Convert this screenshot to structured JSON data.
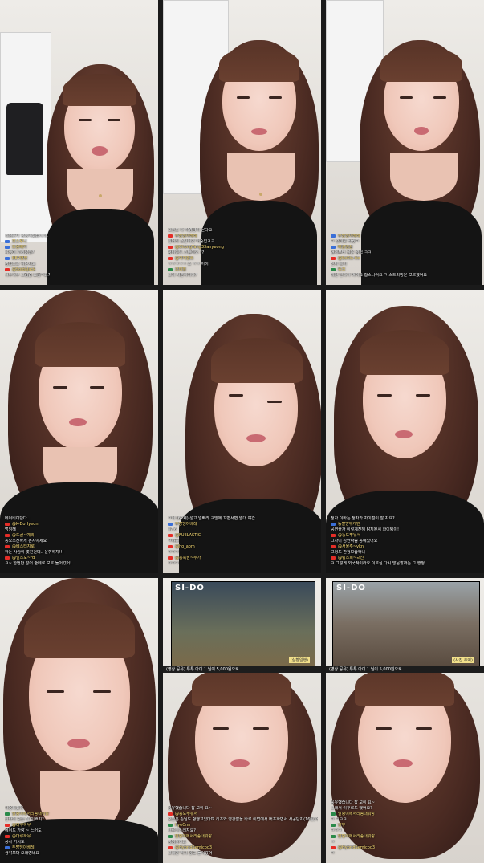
{
  "grid_title": "",
  "tiles": [
    {
      "id": 1,
      "chat": [
        {
          "badge": "none",
          "text": "데일몬이 생생이었습니다."
        },
        {
          "badge": "blue",
          "nick": "보스후니",
          "text": ""
        },
        {
          "badge": "blue",
          "nick": "트윈빼키",
          "text": ""
        },
        {
          "badge": "none",
          "text": "야생에 꼬리장쉽?"
        },
        {
          "badge": "blue",
          "nick": "BEV별빛",
          "text": ""
        },
        {
          "badge": "none",
          "text": "경험으로 쉬운세요"
        },
        {
          "badge": "yt",
          "nick": "@SoldaJack",
          "text": ""
        },
        {
          "badge": "none",
          "text": "너무너무 그럼숍 요즘ㅋ요?"
        }
      ]
    },
    {
      "id": 2,
      "chat": [
        {
          "badge": "none",
          "text": "오늘도 다 야경양이 몬다요"
        },
        {
          "badge": "yt",
          "nick": "두방딩이베레",
          "text": ""
        },
        {
          "badge": "none",
          "text": "흰머리 스탄이면 허중입ㅋㅋ"
        },
        {
          "badge": "yt",
          "nick": "@ChongYang33anyeong",
          "text": ""
        },
        {
          "badge": "none",
          "text": "정비인트 스탠이요 ??"
        },
        {
          "badge": "yt",
          "nick": "@이이합쓰",
          "text": ""
        },
        {
          "badge": "none",
          "text": "ㅋㅋㅋㅋㅋ 쓰 ㅋㅋ 아이"
        },
        {
          "badge": "green",
          "nick": "오미월",
          "text": ""
        },
        {
          "badge": "none",
          "text": "그저 저뿐이지다?"
        }
      ]
    },
    {
      "id": 3,
      "chat": [
        {
          "badge": "blue",
          "nick": "두방딩이베레",
          "text": ""
        },
        {
          "badge": "none",
          "text": "ㅋ 흥미로 바웠ㅋ"
        },
        {
          "badge": "blue",
          "nick": "빠갈임심",
          "text": ""
        },
        {
          "badge": "none",
          "text": "언제부터 실은 경험 ㅋㅋ"
        },
        {
          "badge": "yt",
          "nick": "@SoKia-ito",
          "text": ""
        },
        {
          "badge": "none",
          "text": "진짜 흐이"
        },
        {
          "badge": "green",
          "nick": "뉴크",
          "text": ""
        },
        {
          "badge": "none",
          "text": "예전 닌다가 머이요 합스니어요 ㅋ 스트리밍은 모르겠어요"
        }
      ]
    },
    {
      "id": 4,
      "chat": [
        {
          "badge": "none",
          "text": "데이비이단다.."
        },
        {
          "badge": "yt",
          "nick": "@K-DoHyeon",
          "text": ""
        },
        {
          "badge": "none",
          "text": "멍임해"
        },
        {
          "badge": "yt",
          "nick": "@도골~예리",
          "text": ""
        },
        {
          "badge": "none",
          "text": "응오소진하게 몬지아세요"
        },
        {
          "badge": "yt",
          "nick": "@베스터지로",
          "text": ""
        },
        {
          "badge": "none",
          "text": "하는 사람이 멋진건데.. 운휘하지!!!"
        },
        {
          "badge": "yt",
          "nick": "@밀스포~rd",
          "text": ""
        },
        {
          "badge": "none",
          "text": "ㅋ~ 한번만 성어 줄테로 모르 들어갔어!"
        }
      ]
    },
    {
      "id": 5,
      "chat": [
        {
          "badge": "none",
          "text": "ㅋ이 (62세) 성고 얼빠라 ㅋ빙에 꼬면서면 열대 야간"
        },
        {
          "badge": "blue",
          "nick": "두방딩이베레",
          "text": ""
        },
        {
          "badge": "none",
          "text": "87.6"
        },
        {
          "badge": "yt",
          "nick": "@FUELASTIC",
          "text": ""
        },
        {
          "badge": "none",
          "text": "ㅋ야동"
        },
        {
          "badge": "yt",
          "nick": "@ho_aom",
          "text": ""
        },
        {
          "badge": "none",
          "text": "ㅋㅋㅋ"
        },
        {
          "badge": "yt",
          "nick": "@뭉뚝삼~추가",
          "text": ""
        },
        {
          "badge": "none",
          "text": "ㅋㅋㅋ"
        }
      ]
    },
    {
      "id": 6,
      "chat": [
        {
          "badge": "none",
          "text": "정자 이바는 정자가 차이점이 잘 자요?"
        },
        {
          "badge": "blue",
          "nick": "동팔방투개반",
          "text": ""
        },
        {
          "badge": "none",
          "text": "공연출가 이렇게진해 탐지된서 화이팅이!"
        },
        {
          "badge": "yt",
          "nick": "@동도뿌유서",
          "text": ""
        },
        {
          "badge": "none",
          "text": "그사이 성안싸쯤 응예있어요"
        },
        {
          "badge": "yt",
          "nick": "@서울주~vkn",
          "text": ""
        },
        {
          "badge": "none",
          "text": "그정도 판정모습하니"
        },
        {
          "badge": "yt",
          "nick": "@링스희~ㄹ신",
          "text": ""
        },
        {
          "badge": "none",
          "text": "ㅋ 그렇게 외국적이라요 이르실 다시 방문할까는 그 행정"
        }
      ]
    },
    {
      "id": 7,
      "chat": [
        {
          "badge": "none",
          "text": "사용되겠네"
        },
        {
          "badge": "green",
          "nick": "말벙이에서리종내뭐랑",
          "text": ""
        },
        {
          "badge": "none",
          "text": "한바의 오늘 잠 이쁘지?"
        },
        {
          "badge": "yt",
          "nick": "@마루하우",
          "text": ""
        },
        {
          "badge": "none",
          "text": "에이드 가랑 ~ 느어도"
        },
        {
          "badge": "yt",
          "nick": "@마루하우",
          "text": ""
        },
        {
          "badge": "none",
          "text": "공사 가시도"
        },
        {
          "badge": "blue",
          "nick": "두방딩이베레",
          "text": ""
        },
        {
          "badge": "none",
          "text": "생각보다 오래영네요"
        }
      ]
    },
    {
      "id": 8,
      "overlay_logo": "SI-DO",
      "overlay_tag": "(실황일행)",
      "chat_header": "(영상 공유) 투투 아이 1 님이 5,000원으로",
      "chat": [
        {
          "badge": "none",
          "text": "공유했습니다 잡 보이 요~"
        },
        {
          "badge": "yt",
          "nick": "@동도뿌유서",
          "text": ""
        },
        {
          "badge": "none",
          "text": "오늘은 손님도 헝맹고있다며 리초와 영강잘을 바로 이법에서 버프하면서 서공단지(16원)에서 좋 이유하다에서 다 두고만선이 해진다 7777버지도 이렇게 이중선 지오장역 가정할하네요"
        },
        {
          "badge": "green",
          "nick": "hyeOnn",
          "text": ""
        },
        {
          "badge": "none",
          "text": "다루니스레지요?"
        },
        {
          "badge": "green",
          "nick": "말벙이에서리종내뭐랑",
          "text": ""
        },
        {
          "badge": "none",
          "text": "병님깜이요"
        },
        {
          "badge": "yt",
          "nick": "@HybridSemicoo3",
          "text": ""
        },
        {
          "badge": "none",
          "text": "그래면 역시 공도 들어갔어"
        }
      ]
    },
    {
      "id": 9,
      "overlay_logo": "SI-DO",
      "overlay_tag": "(사진 추억)",
      "chat_header": "(영상 공유) 투투 아이 1 님이 5,000원으로",
      "chat": [
        {
          "badge": "none",
          "text": "공유했습니다 잡 보이 요~"
        },
        {
          "badge": "none",
          "text": "그래서 이후로도 했어요?"
        },
        {
          "badge": "green",
          "nick": "말벙이에서리종내뭐랑",
          "text": ""
        },
        {
          "badge": "none",
          "text": "ㅋ ㅋㅋㅋ"
        },
        {
          "badge": "green",
          "nick": "남부",
          "text": ""
        },
        {
          "badge": "none",
          "text": "ㅋㅋㅋ"
        },
        {
          "badge": "green",
          "nick": "말벙이에서리종내뭐랑",
          "text": ""
        },
        {
          "badge": "none",
          "text": "ㅋ"
        },
        {
          "badge": "yt",
          "nick": "@HybridSemicoo3",
          "text": ""
        },
        {
          "badge": "none",
          "text": "ㅋ"
        }
      ]
    }
  ],
  "colors": {
    "youtube": "#e52d27",
    "blue_badge": "#3a6fd8",
    "green_badge": "#2a8a4a",
    "nick": "#ffe27a"
  }
}
